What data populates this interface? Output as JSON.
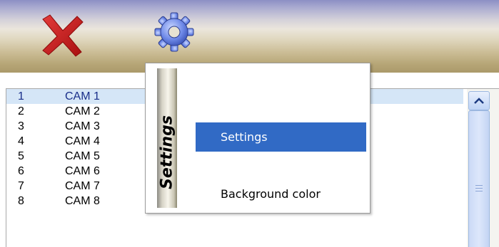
{
  "toolbar": {
    "close_icon": "close-icon",
    "settings_icon": "gear-icon",
    "colors": {
      "close": "#c81a1a",
      "gear": "#4b6bd6"
    }
  },
  "camera_list": {
    "selected_index": 0,
    "rows": [
      {
        "num": "1",
        "name": "CAM 1"
      },
      {
        "num": "2",
        "name": "CAM 2"
      },
      {
        "num": "3",
        "name": "CAM 3"
      },
      {
        "num": "4",
        "name": "CAM 4"
      },
      {
        "num": "5",
        "name": "CAM 5"
      },
      {
        "num": "6",
        "name": "CAM 6"
      },
      {
        "num": "7",
        "name": "CAM 7"
      },
      {
        "num": "8",
        "name": "CAM 8"
      }
    ]
  },
  "menu": {
    "title": "Settings",
    "items": [
      {
        "label": "Settings",
        "active": true
      },
      {
        "label": "Background color",
        "active": false
      }
    ],
    "highlight_color": "#316ac5"
  }
}
